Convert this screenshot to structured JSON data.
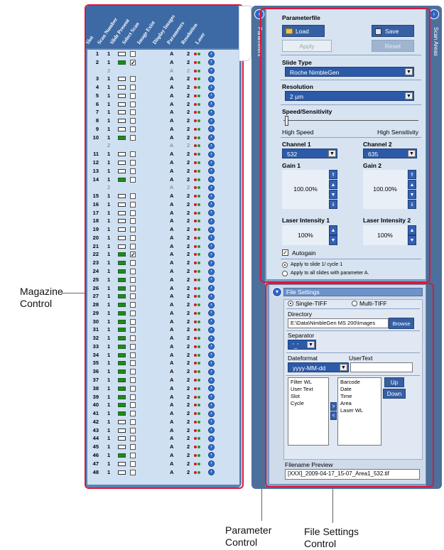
{
  "callouts": {
    "magazine": "Magazine\nControl",
    "parameter": "Parameter\nControl",
    "file_settings": "File Settings\nControl"
  },
  "magazine": {
    "headers": [
      "Slot",
      "Scan Number",
      "Slide Present",
      "Select Scan",
      "Image Exist",
      "Display Images",
      "Parameters",
      "Resolution",
      "Laser"
    ],
    "rows": [
      {
        "slot": "1",
        "scan": "1",
        "present": false,
        "sel": false,
        "a": "A",
        "p": "2"
      },
      {
        "slot": "2",
        "scan": "1",
        "present": true,
        "sel": true,
        "a": "A",
        "p": "2"
      },
      {
        "slot": "",
        "scan": "2",
        "present": null,
        "sel": null,
        "a": "A",
        "p": "2",
        "dim": true
      },
      {
        "slot": "3",
        "scan": "1",
        "present": false,
        "sel": false,
        "a": "A",
        "p": "2"
      },
      {
        "slot": "4",
        "scan": "1",
        "present": false,
        "sel": false,
        "a": "A",
        "p": "2"
      },
      {
        "slot": "5",
        "scan": "1",
        "present": false,
        "sel": false,
        "a": "A",
        "p": "2"
      },
      {
        "slot": "6",
        "scan": "1",
        "present": false,
        "sel": false,
        "a": "A",
        "p": "2"
      },
      {
        "slot": "7",
        "scan": "1",
        "present": false,
        "sel": false,
        "a": "A",
        "p": "2"
      },
      {
        "slot": "8",
        "scan": "1",
        "present": false,
        "sel": false,
        "a": "A",
        "p": "2"
      },
      {
        "slot": "9",
        "scan": "1",
        "present": false,
        "sel": false,
        "a": "A",
        "p": "2"
      },
      {
        "slot": "10",
        "scan": "1",
        "present": true,
        "sel": false,
        "a": "A",
        "p": "2"
      },
      {
        "slot": "",
        "scan": "2",
        "present": null,
        "sel": null,
        "a": "A",
        "p": "2",
        "dim": true
      },
      {
        "slot": "11",
        "scan": "1",
        "present": false,
        "sel": false,
        "a": "A",
        "p": "2"
      },
      {
        "slot": "12",
        "scan": "1",
        "present": false,
        "sel": false,
        "a": "A",
        "p": "2"
      },
      {
        "slot": "13",
        "scan": "1",
        "present": false,
        "sel": false,
        "a": "A",
        "p": "2"
      },
      {
        "slot": "14",
        "scan": "1",
        "present": true,
        "sel": false,
        "a": "A",
        "p": "2"
      },
      {
        "slot": "",
        "scan": "2",
        "present": null,
        "sel": null,
        "a": "A",
        "p": "2",
        "dim": true
      },
      {
        "slot": "15",
        "scan": "1",
        "present": false,
        "sel": false,
        "a": "A",
        "p": "2"
      },
      {
        "slot": "16",
        "scan": "1",
        "present": false,
        "sel": false,
        "a": "A",
        "p": "2"
      },
      {
        "slot": "17",
        "scan": "1",
        "present": false,
        "sel": false,
        "a": "A",
        "p": "2"
      },
      {
        "slot": "18",
        "scan": "1",
        "present": false,
        "sel": false,
        "a": "A",
        "p": "2"
      },
      {
        "slot": "19",
        "scan": "1",
        "present": false,
        "sel": false,
        "a": "A",
        "p": "2"
      },
      {
        "slot": "20",
        "scan": "1",
        "present": false,
        "sel": false,
        "a": "A",
        "p": "2"
      },
      {
        "slot": "21",
        "scan": "1",
        "present": false,
        "sel": false,
        "a": "A",
        "p": "2"
      },
      {
        "slot": "22",
        "scan": "1",
        "present": true,
        "sel": true,
        "a": "A",
        "p": "2"
      },
      {
        "slot": "23",
        "scan": "1",
        "present": true,
        "sel": false,
        "a": "A",
        "p": "2"
      },
      {
        "slot": "24",
        "scan": "1",
        "present": true,
        "sel": false,
        "a": "A",
        "p": "2"
      },
      {
        "slot": "25",
        "scan": "1",
        "present": true,
        "sel": false,
        "a": "A",
        "p": "2"
      },
      {
        "slot": "26",
        "scan": "1",
        "present": true,
        "sel": false,
        "a": "A",
        "p": "2"
      },
      {
        "slot": "27",
        "scan": "1",
        "present": true,
        "sel": false,
        "a": "A",
        "p": "2"
      },
      {
        "slot": "28",
        "scan": "1",
        "present": true,
        "sel": false,
        "a": "A",
        "p": "2"
      },
      {
        "slot": "29",
        "scan": "1",
        "present": true,
        "sel": false,
        "a": "A",
        "p": "2"
      },
      {
        "slot": "30",
        "scan": "1",
        "present": true,
        "sel": false,
        "a": "A",
        "p": "2"
      },
      {
        "slot": "31",
        "scan": "1",
        "present": true,
        "sel": false,
        "a": "A",
        "p": "2"
      },
      {
        "slot": "32",
        "scan": "1",
        "present": true,
        "sel": false,
        "a": "A",
        "p": "2"
      },
      {
        "slot": "33",
        "scan": "1",
        "present": true,
        "sel": false,
        "a": "A",
        "p": "2"
      },
      {
        "slot": "34",
        "scan": "1",
        "present": true,
        "sel": false,
        "a": "A",
        "p": "2"
      },
      {
        "slot": "35",
        "scan": "1",
        "present": true,
        "sel": false,
        "a": "A",
        "p": "2"
      },
      {
        "slot": "36",
        "scan": "1",
        "present": true,
        "sel": false,
        "a": "A",
        "p": "2"
      },
      {
        "slot": "37",
        "scan": "1",
        "present": true,
        "sel": false,
        "a": "A",
        "p": "2"
      },
      {
        "slot": "38",
        "scan": "1",
        "present": true,
        "sel": false,
        "a": "A",
        "p": "2"
      },
      {
        "slot": "39",
        "scan": "1",
        "present": true,
        "sel": false,
        "a": "A",
        "p": "2"
      },
      {
        "slot": "40",
        "scan": "1",
        "present": true,
        "sel": false,
        "a": "A",
        "p": "2"
      },
      {
        "slot": "41",
        "scan": "1",
        "present": true,
        "sel": false,
        "a": "A",
        "p": "2"
      },
      {
        "slot": "42",
        "scan": "1",
        "present": false,
        "sel": false,
        "a": "A",
        "p": "2"
      },
      {
        "slot": "43",
        "scan": "1",
        "present": false,
        "sel": false,
        "a": "A",
        "p": "2"
      },
      {
        "slot": "44",
        "scan": "1",
        "present": false,
        "sel": false,
        "a": "A",
        "p": "2"
      },
      {
        "slot": "45",
        "scan": "1",
        "present": false,
        "sel": false,
        "a": "A",
        "p": "2"
      },
      {
        "slot": "46",
        "scan": "1",
        "present": true,
        "sel": false,
        "a": "A",
        "p": "2"
      },
      {
        "slot": "47",
        "scan": "1",
        "present": false,
        "sel": false,
        "a": "A",
        "p": "2"
      },
      {
        "slot": "48",
        "scan": "1",
        "present": false,
        "sel": false,
        "a": "A",
        "p": "2"
      }
    ]
  },
  "side_tabs": {
    "parameters": "Parameters",
    "scan_areas": "Scan Areas"
  },
  "parameters": {
    "file_title": "Parameterfile",
    "load": "Load",
    "save": "Save",
    "apply": "Apply",
    "reset": "Reset",
    "slide_type_label": "Slide Type",
    "slide_type": "Roche NimbleGen",
    "resolution_label": "Resolution",
    "resolution": "2 µm",
    "speed_label": "Speed/Sensitivity",
    "speed_low": "High Speed",
    "speed_high": "High Sensitivity",
    "ch1_label": "Channel 1",
    "ch1": "532",
    "ch2_label": "Channel 2",
    "ch2": "635",
    "gain1_label": "Gain 1",
    "gain1": "100.00%",
    "gain2_label": "Gain 2",
    "gain2": "100.00%",
    "laser1_label": "Laser Intensity 1",
    "laser1": "100%",
    "laser2_label": "Laser Intensity 2",
    "laser2": "100%",
    "autogain": "Autogain",
    "apply_slide": "Apply to slide 1/ cycle 1",
    "apply_all": "Apply to all slides with parameter A."
  },
  "file_settings": {
    "title": "File Settings",
    "single": "Single-TIFF",
    "multi": "Multi-TIFF",
    "directory_label": "Directory",
    "directory": "E:\\Data\\NimbleGen MS 200\\Images",
    "browse": "Browse",
    "separator_label": "Separator",
    "separator": "'_'",
    "dateformat_label": "Dateformat",
    "dateformat": "yyyy-MM-dd",
    "usertext_label": "UserText",
    "left_items": [
      "Filter WL",
      "User Text",
      "Slot",
      "Cycle"
    ],
    "right_items": [
      "Barcode",
      "Date",
      "Time",
      "Area",
      "Laser  WL"
    ],
    "up": "Up",
    "down": "Down",
    "move_right": ">",
    "move_left": "<",
    "preview_label": "Filename Preview",
    "preview": "[XXX]_2009-04-17_15-07_Area1_532.tif"
  }
}
